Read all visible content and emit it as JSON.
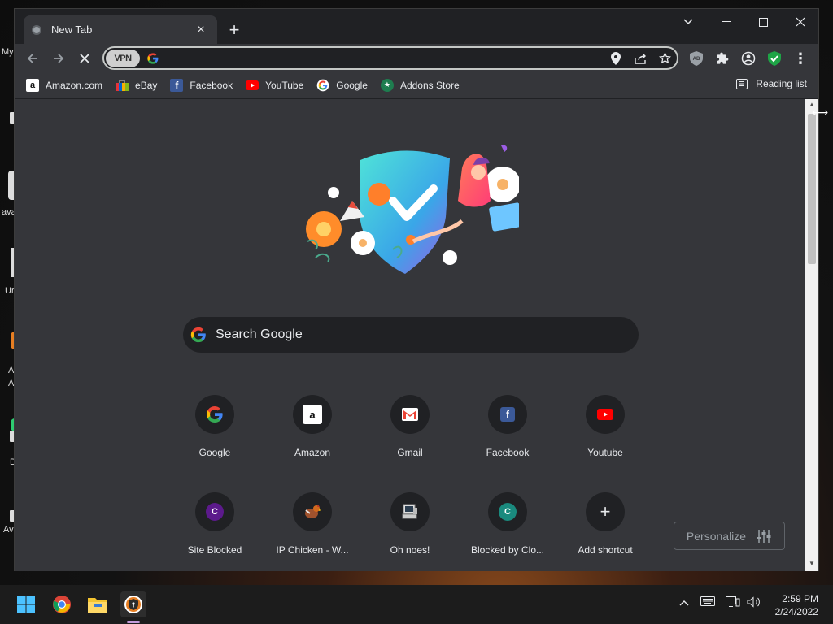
{
  "desktop": {
    "labels": [
      "My",
      "ava",
      "Ur",
      "A",
      "A",
      "D",
      "Av"
    ]
  },
  "tab": {
    "title": "New Tab",
    "close": "×"
  },
  "window_controls": {
    "dropdown": "⌄",
    "minimize": "—",
    "maximize": "☐",
    "close": "✕",
    "new_tab": "+"
  },
  "toolbar": {
    "back": "←",
    "forward": "→",
    "stop": "✕",
    "vpn_label": "VPN",
    "url_value": "",
    "menu": "⋮"
  },
  "bookmarks": [
    {
      "label": "Amazon.com",
      "icon": "amazon-icon"
    },
    {
      "label": "eBay",
      "icon": "ebay-icon"
    },
    {
      "label": "Facebook",
      "icon": "facebook-icon"
    },
    {
      "label": "YouTube",
      "icon": "youtube-icon"
    },
    {
      "label": "Google",
      "icon": "google-icon"
    },
    {
      "label": "Addons Store",
      "icon": "addons-store-icon"
    }
  ],
  "reading_list": "Reading list",
  "search": {
    "placeholder": "Search Google"
  },
  "shortcuts": [
    {
      "label": "Google",
      "icon": "google-icon"
    },
    {
      "label": "Amazon",
      "icon": "amazon-icon"
    },
    {
      "label": "Gmail",
      "icon": "gmail-icon"
    },
    {
      "label": "Facebook",
      "icon": "facebook-icon"
    },
    {
      "label": "Youtube",
      "icon": "youtube-icon"
    },
    {
      "label": "Site Blocked",
      "icon": "letter-c-icon",
      "letter": "C"
    },
    {
      "label": "IP Chicken - W...",
      "icon": "chicken-icon"
    },
    {
      "label": "Oh noes!",
      "icon": "computer-icon"
    },
    {
      "label": "Blocked by Clo...",
      "icon": "letter-c-icon",
      "letter": "C"
    },
    {
      "label": "Add shortcut",
      "icon": "plus-icon",
      "symbol": "+"
    }
  ],
  "personalize": "Personalize",
  "taskbar": {
    "time": "2:59 PM",
    "date": "2/24/2022",
    "tray_up": "^"
  },
  "colors": {
    "accent": "#8ab4f8",
    "content_bg": "#35363a",
    "shield": "#3dd6d0"
  }
}
